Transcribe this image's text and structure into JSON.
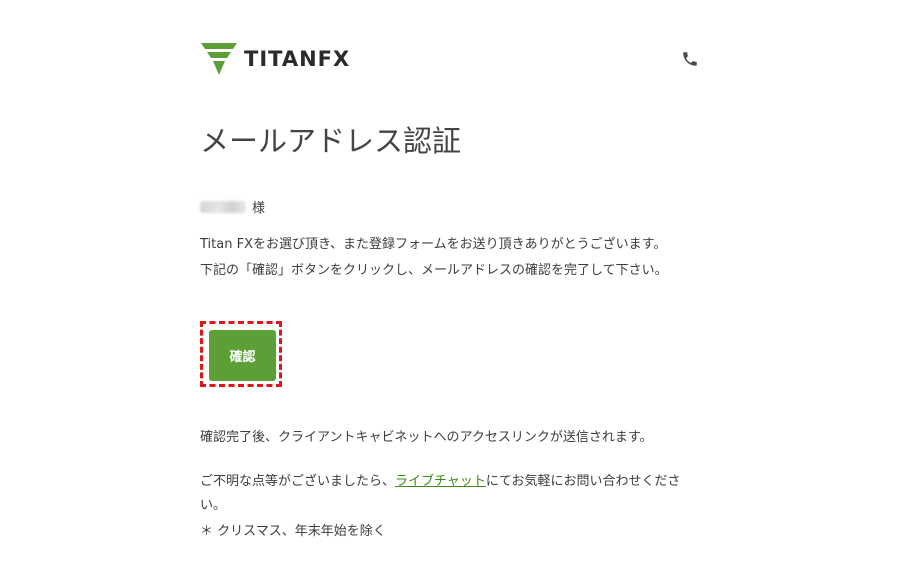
{
  "brand": {
    "name": "TITANFX",
    "logo_color": "#5b9f36"
  },
  "header": {
    "phone_icon": "phone-icon"
  },
  "title": "メールアドレス認証",
  "greeting": {
    "honorific": "様"
  },
  "message": {
    "line1": "Titan FXをお選び頂き、また登録フォームをお送り頂きありがとうございます。",
    "line2": "下記の「確認」ボタンをクリックし、メールアドレスの確認を完了して下さい。"
  },
  "confirm_button": {
    "label": "確認",
    "color": "#5b9f36",
    "highlight_color": "#e0161b"
  },
  "after_note": "確認完了後、クライアントキャビネットへのアクセスリンクが送信されます。",
  "contact": {
    "prefix": "ご不明な点等がございましたら、",
    "link_label": "ライブチャット",
    "suffix": "にてお気軽にお問い合わせください。",
    "link_color": "#3a8a1c"
  },
  "holiday_note": "＊ クリスマス、年末年始を除く"
}
